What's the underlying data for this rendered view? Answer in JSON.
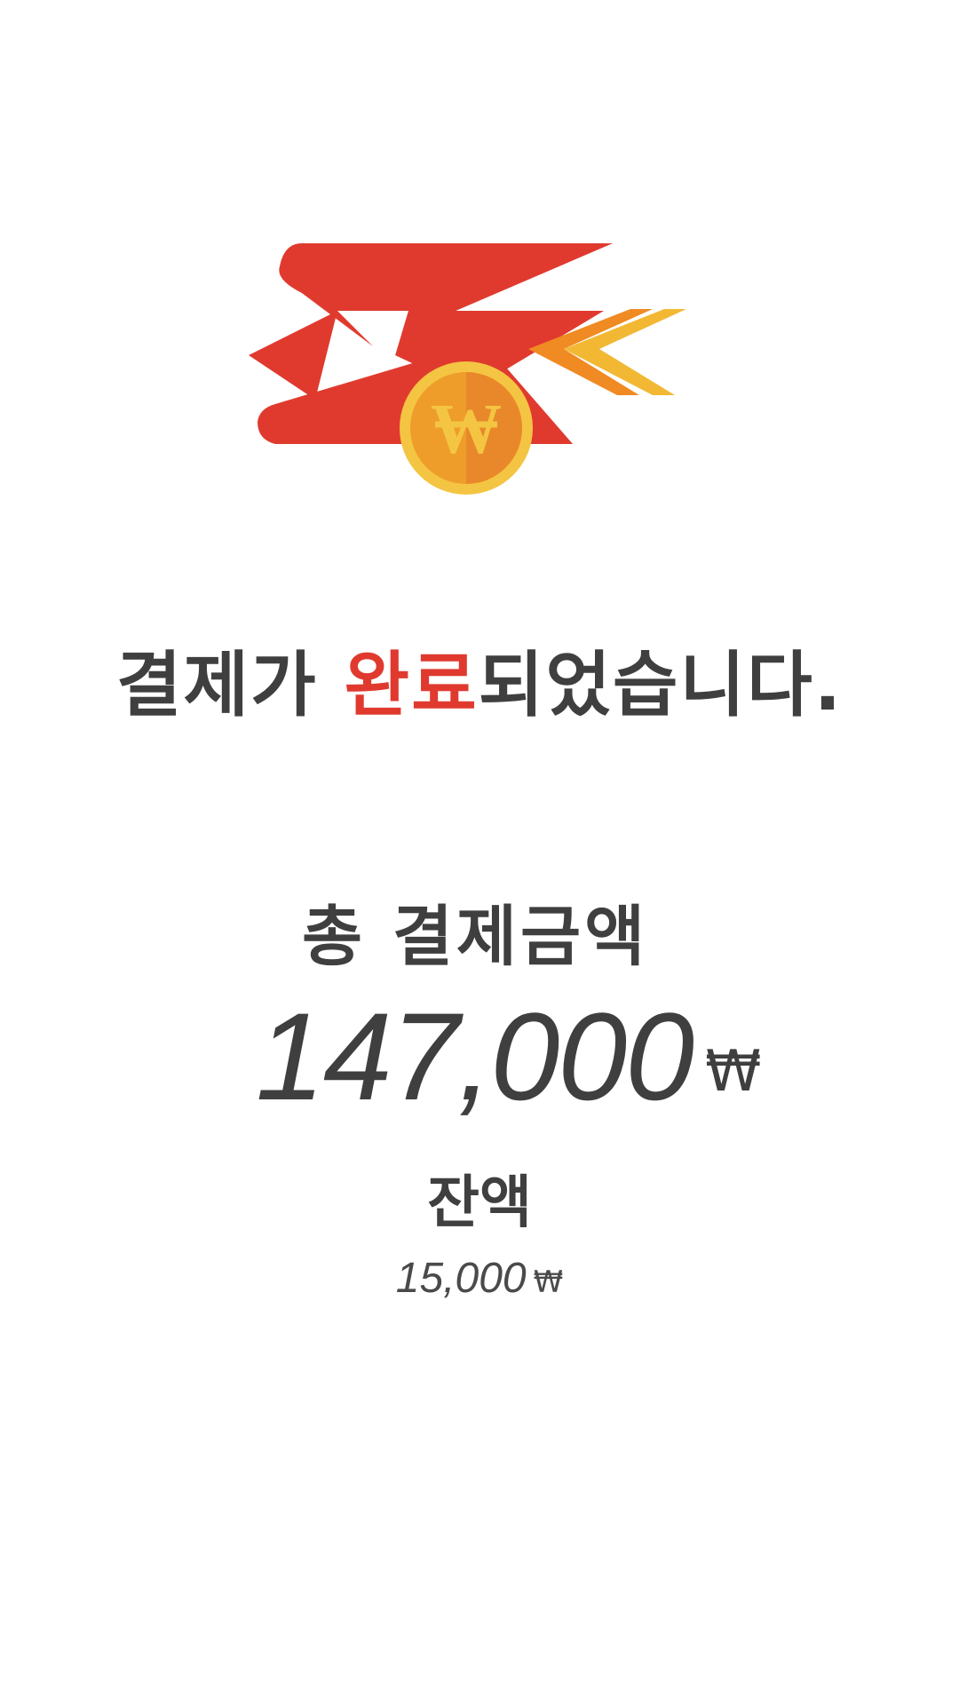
{
  "app": {
    "logo": {
      "icon": "payment-logo-icon",
      "coin_symbol": "W",
      "colors": {
        "red": "#e03a2f",
        "orange": "#f08a22",
        "yellow": "#f2c14e",
        "coin_outer": "#f4c542",
        "coin_inner": "#ee9d2b"
      }
    },
    "message": {
      "prefix": "결제가 ",
      "highlight": "완료",
      "suffix": "되었습니다."
    },
    "total": {
      "label": "총 결제금액",
      "value": "147,000",
      "currency": "₩"
    },
    "balance": {
      "label": "잔액",
      "value": "15,000",
      "currency": "₩"
    }
  }
}
